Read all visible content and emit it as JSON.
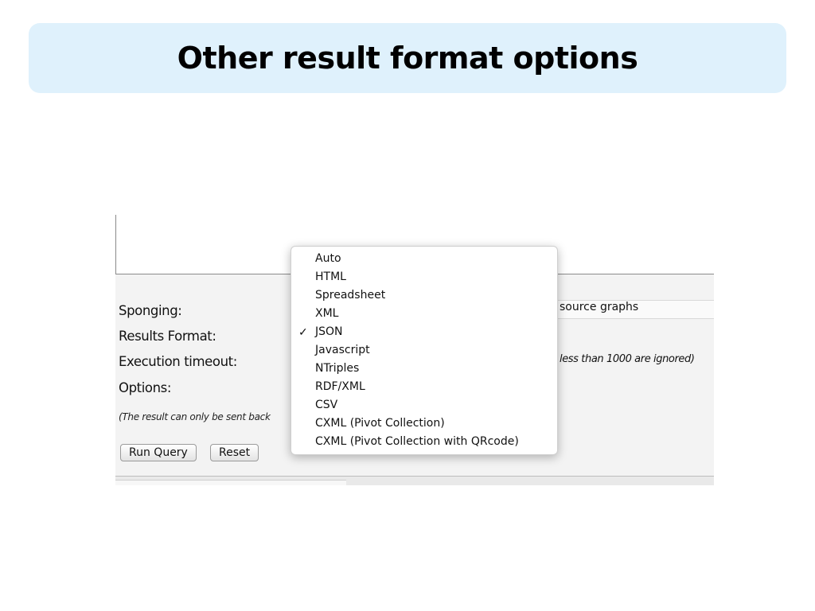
{
  "slide": {
    "title": "Other result format options"
  },
  "form": {
    "labels": {
      "sponging": "Sponging:",
      "results_format": "Results Format:",
      "execution_timeout": "Execution timeout:",
      "options": "Options:"
    },
    "note": "(The result can only be sent back",
    "sponging_value_tail": "source graphs",
    "timeout_hint_tail": "less than 1000 are ignored)",
    "buttons": {
      "run_query": "Run Query",
      "reset": "Reset"
    }
  },
  "format_menu": {
    "items": [
      "Auto",
      "HTML",
      "Spreadsheet",
      "XML",
      "JSON",
      "Javascript",
      "NTriples",
      "RDF/XML",
      "CSV",
      "CXML (Pivot Collection)",
      "CXML (Pivot Collection with QRcode)"
    ],
    "selected": "JSON",
    "check_mark": "✓"
  }
}
